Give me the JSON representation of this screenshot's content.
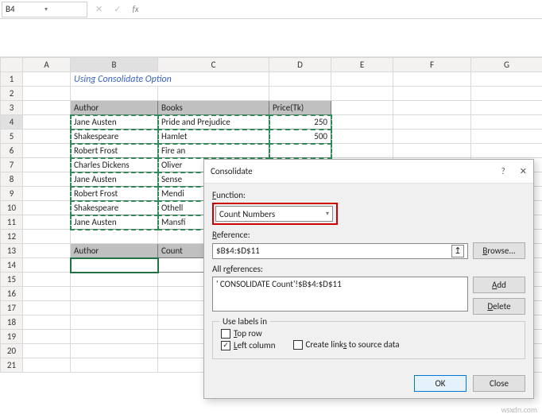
{
  "namebox": {
    "value": "B4"
  },
  "fx": {
    "cancel": "✕",
    "confirm": "✓",
    "fx": "fx"
  },
  "cols": {
    "A": "A",
    "B": "B",
    "C": "C",
    "D": "D",
    "E": "E",
    "F": "F",
    "G": "G"
  },
  "title_row": "Using Consolidate Option",
  "headers": {
    "author": "Author",
    "books": "Books",
    "price": "Price(Tk)",
    "count": "Count"
  },
  "rows": [
    {
      "author": "Jane Austen",
      "book": "Pride and Prejudice",
      "price": "250"
    },
    {
      "author": "Shakespeare",
      "book": "Hamlet",
      "price": "500"
    },
    {
      "author": "Robert Frost",
      "book": "Fire an",
      "price": ""
    },
    {
      "author": "Charles Dickens",
      "book": "Oliver",
      "price": ""
    },
    {
      "author": "Jane Austen",
      "book": "Sense",
      "price": ""
    },
    {
      "author": "Robert Frost",
      "book": "Mendi",
      "price": ""
    },
    {
      "author": "Shakespeare",
      "book": "Othell",
      "price": ""
    },
    {
      "author": "Jane Austen",
      "book": "Mansfi",
      "price": ""
    }
  ],
  "rownums": [
    "1",
    "2",
    "3",
    "4",
    "5",
    "6",
    "7",
    "8",
    "9",
    "10",
    "11",
    "12",
    "13",
    "14",
    "15",
    "16",
    "17",
    "18",
    "19",
    "20",
    "21"
  ],
  "dialog": {
    "title": "Consolidate",
    "help": "?",
    "close": "✕",
    "function_label": "Function:",
    "function_value": "Count Numbers",
    "reference_label": "Reference:",
    "reference_value": "$B$4:$D$11",
    "allrefs_label": "All references:",
    "allrefs_item": "' CONSOLIDATE Count'!$B$4:$D$11",
    "browse": "Browse...",
    "add": "Add",
    "delete": "Delete",
    "group_legend": "Use labels in",
    "top_row": "Top row",
    "left_col": "Left column",
    "links": "Create links to source data",
    "ok": "OK",
    "closebtn": "Close"
  },
  "watermark": "wsxdn.com",
  "icons": {
    "chev": "▾",
    "picker": "↥",
    "check": "✓"
  }
}
